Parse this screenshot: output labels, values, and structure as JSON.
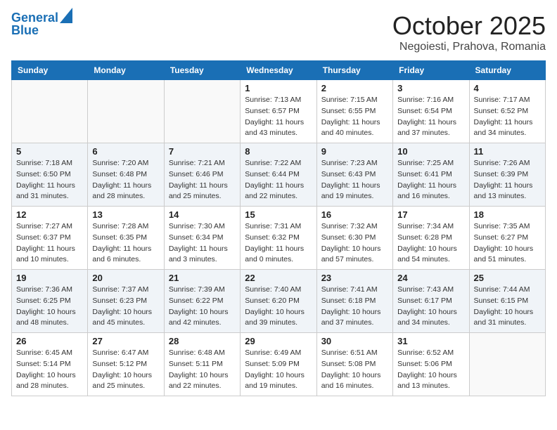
{
  "header": {
    "logo_line1": "General",
    "logo_line2": "Blue",
    "title": "October 2025",
    "subtitle": "Negoiesti, Prahova, Romania"
  },
  "weekdays": [
    "Sunday",
    "Monday",
    "Tuesday",
    "Wednesday",
    "Thursday",
    "Friday",
    "Saturday"
  ],
  "weeks": [
    [
      {
        "day": "",
        "info": ""
      },
      {
        "day": "",
        "info": ""
      },
      {
        "day": "",
        "info": ""
      },
      {
        "day": "1",
        "info": "Sunrise: 7:13 AM\nSunset: 6:57 PM\nDaylight: 11 hours and 43 minutes."
      },
      {
        "day": "2",
        "info": "Sunrise: 7:15 AM\nSunset: 6:55 PM\nDaylight: 11 hours and 40 minutes."
      },
      {
        "day": "3",
        "info": "Sunrise: 7:16 AM\nSunset: 6:54 PM\nDaylight: 11 hours and 37 minutes."
      },
      {
        "day": "4",
        "info": "Sunrise: 7:17 AM\nSunset: 6:52 PM\nDaylight: 11 hours and 34 minutes."
      }
    ],
    [
      {
        "day": "5",
        "info": "Sunrise: 7:18 AM\nSunset: 6:50 PM\nDaylight: 11 hours and 31 minutes."
      },
      {
        "day": "6",
        "info": "Sunrise: 7:20 AM\nSunset: 6:48 PM\nDaylight: 11 hours and 28 minutes."
      },
      {
        "day": "7",
        "info": "Sunrise: 7:21 AM\nSunset: 6:46 PM\nDaylight: 11 hours and 25 minutes."
      },
      {
        "day": "8",
        "info": "Sunrise: 7:22 AM\nSunset: 6:44 PM\nDaylight: 11 hours and 22 minutes."
      },
      {
        "day": "9",
        "info": "Sunrise: 7:23 AM\nSunset: 6:43 PM\nDaylight: 11 hours and 19 minutes."
      },
      {
        "day": "10",
        "info": "Sunrise: 7:25 AM\nSunset: 6:41 PM\nDaylight: 11 hours and 16 minutes."
      },
      {
        "day": "11",
        "info": "Sunrise: 7:26 AM\nSunset: 6:39 PM\nDaylight: 11 hours and 13 minutes."
      }
    ],
    [
      {
        "day": "12",
        "info": "Sunrise: 7:27 AM\nSunset: 6:37 PM\nDaylight: 11 hours and 10 minutes."
      },
      {
        "day": "13",
        "info": "Sunrise: 7:28 AM\nSunset: 6:35 PM\nDaylight: 11 hours and 6 minutes."
      },
      {
        "day": "14",
        "info": "Sunrise: 7:30 AM\nSunset: 6:34 PM\nDaylight: 11 hours and 3 minutes."
      },
      {
        "day": "15",
        "info": "Sunrise: 7:31 AM\nSunset: 6:32 PM\nDaylight: 11 hours and 0 minutes."
      },
      {
        "day": "16",
        "info": "Sunrise: 7:32 AM\nSunset: 6:30 PM\nDaylight: 10 hours and 57 minutes."
      },
      {
        "day": "17",
        "info": "Sunrise: 7:34 AM\nSunset: 6:28 PM\nDaylight: 10 hours and 54 minutes."
      },
      {
        "day": "18",
        "info": "Sunrise: 7:35 AM\nSunset: 6:27 PM\nDaylight: 10 hours and 51 minutes."
      }
    ],
    [
      {
        "day": "19",
        "info": "Sunrise: 7:36 AM\nSunset: 6:25 PM\nDaylight: 10 hours and 48 minutes."
      },
      {
        "day": "20",
        "info": "Sunrise: 7:37 AM\nSunset: 6:23 PM\nDaylight: 10 hours and 45 minutes."
      },
      {
        "day": "21",
        "info": "Sunrise: 7:39 AM\nSunset: 6:22 PM\nDaylight: 10 hours and 42 minutes."
      },
      {
        "day": "22",
        "info": "Sunrise: 7:40 AM\nSunset: 6:20 PM\nDaylight: 10 hours and 39 minutes."
      },
      {
        "day": "23",
        "info": "Sunrise: 7:41 AM\nSunset: 6:18 PM\nDaylight: 10 hours and 37 minutes."
      },
      {
        "day": "24",
        "info": "Sunrise: 7:43 AM\nSunset: 6:17 PM\nDaylight: 10 hours and 34 minutes."
      },
      {
        "day": "25",
        "info": "Sunrise: 7:44 AM\nSunset: 6:15 PM\nDaylight: 10 hours and 31 minutes."
      }
    ],
    [
      {
        "day": "26",
        "info": "Sunrise: 6:45 AM\nSunset: 5:14 PM\nDaylight: 10 hours and 28 minutes."
      },
      {
        "day": "27",
        "info": "Sunrise: 6:47 AM\nSunset: 5:12 PM\nDaylight: 10 hours and 25 minutes."
      },
      {
        "day": "28",
        "info": "Sunrise: 6:48 AM\nSunset: 5:11 PM\nDaylight: 10 hours and 22 minutes."
      },
      {
        "day": "29",
        "info": "Sunrise: 6:49 AM\nSunset: 5:09 PM\nDaylight: 10 hours and 19 minutes."
      },
      {
        "day": "30",
        "info": "Sunrise: 6:51 AM\nSunset: 5:08 PM\nDaylight: 10 hours and 16 minutes."
      },
      {
        "day": "31",
        "info": "Sunrise: 6:52 AM\nSunset: 5:06 PM\nDaylight: 10 hours and 13 minutes."
      },
      {
        "day": "",
        "info": ""
      }
    ]
  ]
}
